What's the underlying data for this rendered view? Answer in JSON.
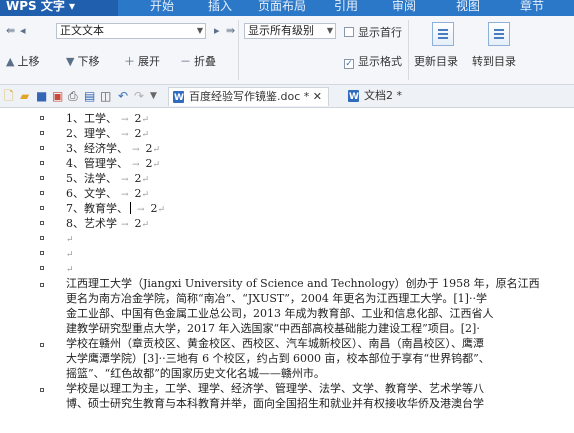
{
  "titlebar": {
    "app_name": "WPS 文字",
    "tabs": [
      "开始",
      "插入",
      "页面布局",
      "引用",
      "审阅",
      "视图",
      "章节"
    ]
  },
  "toolbar": {
    "style_combo": "正文文本",
    "level_combo": "显示所有级别",
    "show_first_line": "显示首行",
    "show_format": "显示格式",
    "up": "上移",
    "down": "下移",
    "expand": "展开",
    "collapse": "折叠",
    "update_toc": "更新目录",
    "goto_toc": "转到目录"
  },
  "doc_tabs": [
    {
      "label": "百度经验写作镜鉴.doc * ✕"
    },
    {
      "label": "文档2 *"
    }
  ],
  "document": {
    "list_items": [
      {
        "label": "1、工学、",
        "value": "2"
      },
      {
        "label": "2、理学、",
        "value": "2"
      },
      {
        "label": "3、经济学、",
        "value": "2"
      },
      {
        "label": "4、管理学、",
        "value": "2"
      },
      {
        "label": "5、法学、",
        "value": "2"
      },
      {
        "label": "6、文学、",
        "value": "2"
      },
      {
        "label": "7、教育学、",
        "value": "2"
      },
      {
        "label": "8、艺术学",
        "value": "2"
      }
    ],
    "para1_lines": [
      "江西理工大学（Jiangxi University of Science and Technology）创办于 1958 年，原名江西",
      "更名为南方冶金学院，简称“南冶”、“JXUST”，2004 年更名为江西理工大学。[1]··学",
      "金工业部、中国有色金属工业总公司，2013 年成为教育部、工业和信息化部、江西省人",
      "建教学研究型重点大学，2017 年入选国家“中西部高校基础能力建设工程”项目。[2]·"
    ],
    "para2_lines": [
      "学校在赣州（章贡校区、黄金校区、西校区、汽车城新校区）、南昌（南昌校区）、鹰潭",
      "大学鹰潭学院）[3]··三地有 6 个校区，约占到 6000 亩，校本部位于享有“世界钨都”、",
      "摇篮”、“红色故都”的国家历史文化名城——赣州市。"
    ],
    "para3_lines": [
      "学校是以理工为主，工学、理学、经济学、管理学、法学、文学、教育学、艺术学等八",
      "博、硕士研究生教育与本科教育并举，面向全国招生和就业并有权接收华侨及港澳台学"
    ]
  }
}
